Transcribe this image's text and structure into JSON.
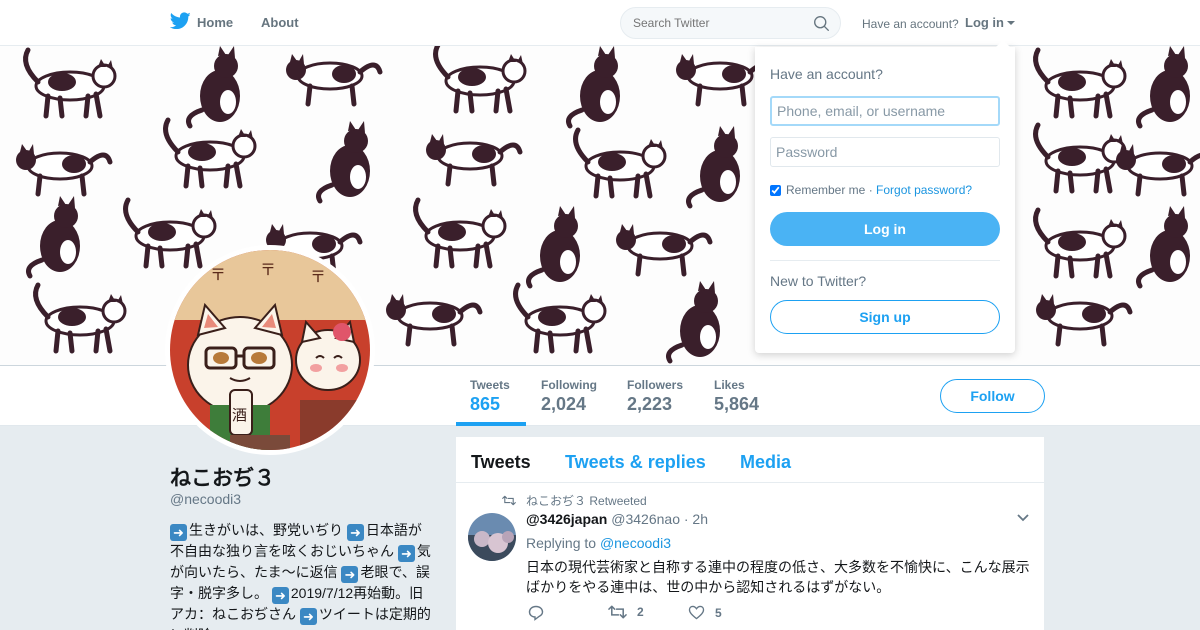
{
  "nav": {
    "home_label": "Home",
    "about_label": "About",
    "search_placeholder": "Search Twitter",
    "have_account": "Have an account?",
    "login_label": "Log in"
  },
  "profile": {
    "name": "ねこおぢ３",
    "handle": "@necoodi3",
    "bio": [
      "生きがいは、野党いぢり ",
      "日本語が不自由な独り言を呟くおじいちゃん ",
      "気が向いたら、たま～に返信 ",
      "老眼で、誤字・脱字多し。 ",
      "2019/7/12再始動。旧アカ：ねこおぢさん ",
      "ツイートは定期的に削除"
    ],
    "follow_label": "Follow"
  },
  "stats": [
    {
      "label": "Tweets",
      "value": "865"
    },
    {
      "label": "Following",
      "value": "2,024"
    },
    {
      "label": "Followers",
      "value": "2,223"
    },
    {
      "label": "Likes",
      "value": "5,864"
    }
  ],
  "timeline": {
    "tabs": [
      "Tweets",
      "Tweets & replies",
      "Media"
    ],
    "tweet": {
      "retweeted_by": "ねこおぢ３",
      "retweeted_label": "Retweeted",
      "name": "@3426japan",
      "handle": "@3426nao",
      "time": "· 2h",
      "replying_to_label": "Replying to",
      "replying_to_handle": "@necoodi3",
      "text": "日本の現代芸術家と自称する連中の程度の低さ、大多数を不愉快に、こんな展示ばかりをやる連中は、世の中から認知されるはずがない。",
      "retweets": "2",
      "likes": "5"
    }
  },
  "login_dropdown": {
    "title": "Have an account?",
    "username_placeholder": "Phone, email, or username",
    "password_placeholder": "Password",
    "remember_label": "Remember me",
    "separator": "·",
    "forgot_label": "Forgot password?",
    "login_button": "Log in",
    "new_label": "New to Twitter?",
    "signup_button": "Sign up"
  },
  "colors": {
    "accent": "#1da1f2",
    "login_button": "#4ab3f4",
    "banner_cat_dark": "#3a1f2b"
  },
  "icons": {
    "brand": "twitter-bird-icon",
    "search": "search-icon",
    "retweet": "retweet-icon",
    "reply": "reply-icon",
    "like": "heart-icon",
    "more": "chevron-down-icon",
    "bio_arrow": "arrow-right-emoji-icon"
  }
}
